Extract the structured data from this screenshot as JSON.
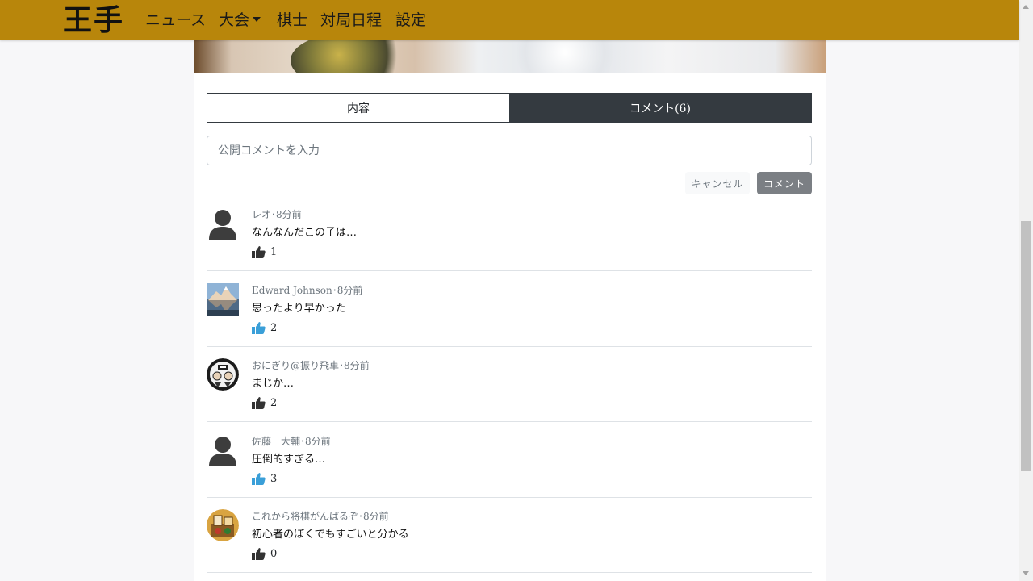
{
  "nav": {
    "logo": "王手",
    "items": [
      "ニュース",
      "大会",
      "棋士",
      "対局日程",
      "設定"
    ]
  },
  "tabs": [
    {
      "label": "内容",
      "active": false
    },
    {
      "label": "コメント(6)",
      "active": true
    }
  ],
  "comment_form": {
    "placeholder": "公開コメントを入力",
    "cancel_label": "キャンセル",
    "submit_label": "コメント"
  },
  "comments": [
    {
      "meta": "レオ･8分前",
      "text": "なんなんだこの子は…",
      "likes": "1",
      "liked": false,
      "avatar": "default-user"
    },
    {
      "meta": "Edward Johnson･8分前",
      "text": "思ったより早かった",
      "likes": "2",
      "liked": true,
      "avatar": "mountain-photo"
    },
    {
      "meta": "おにぎり@振り飛車･8分前",
      "text": "まじか…",
      "likes": "2",
      "liked": false,
      "avatar": "cartoon-face"
    },
    {
      "meta": "佐藤　大輔･8分前",
      "text": "圧倒的すぎる…",
      "likes": "3",
      "liked": true,
      "avatar": "default-user"
    },
    {
      "meta": "これから将棋がんばるぞ･8分前",
      "text": "初心者のぼくでもすごいと分かる",
      "likes": "0",
      "liked": false,
      "avatar": "shogi-illustration"
    }
  ],
  "colors": {
    "navbar": "#b8860b",
    "tab_active": "#343a40",
    "like_active": "#3a9fd8",
    "like_inactive": "#333333"
  }
}
